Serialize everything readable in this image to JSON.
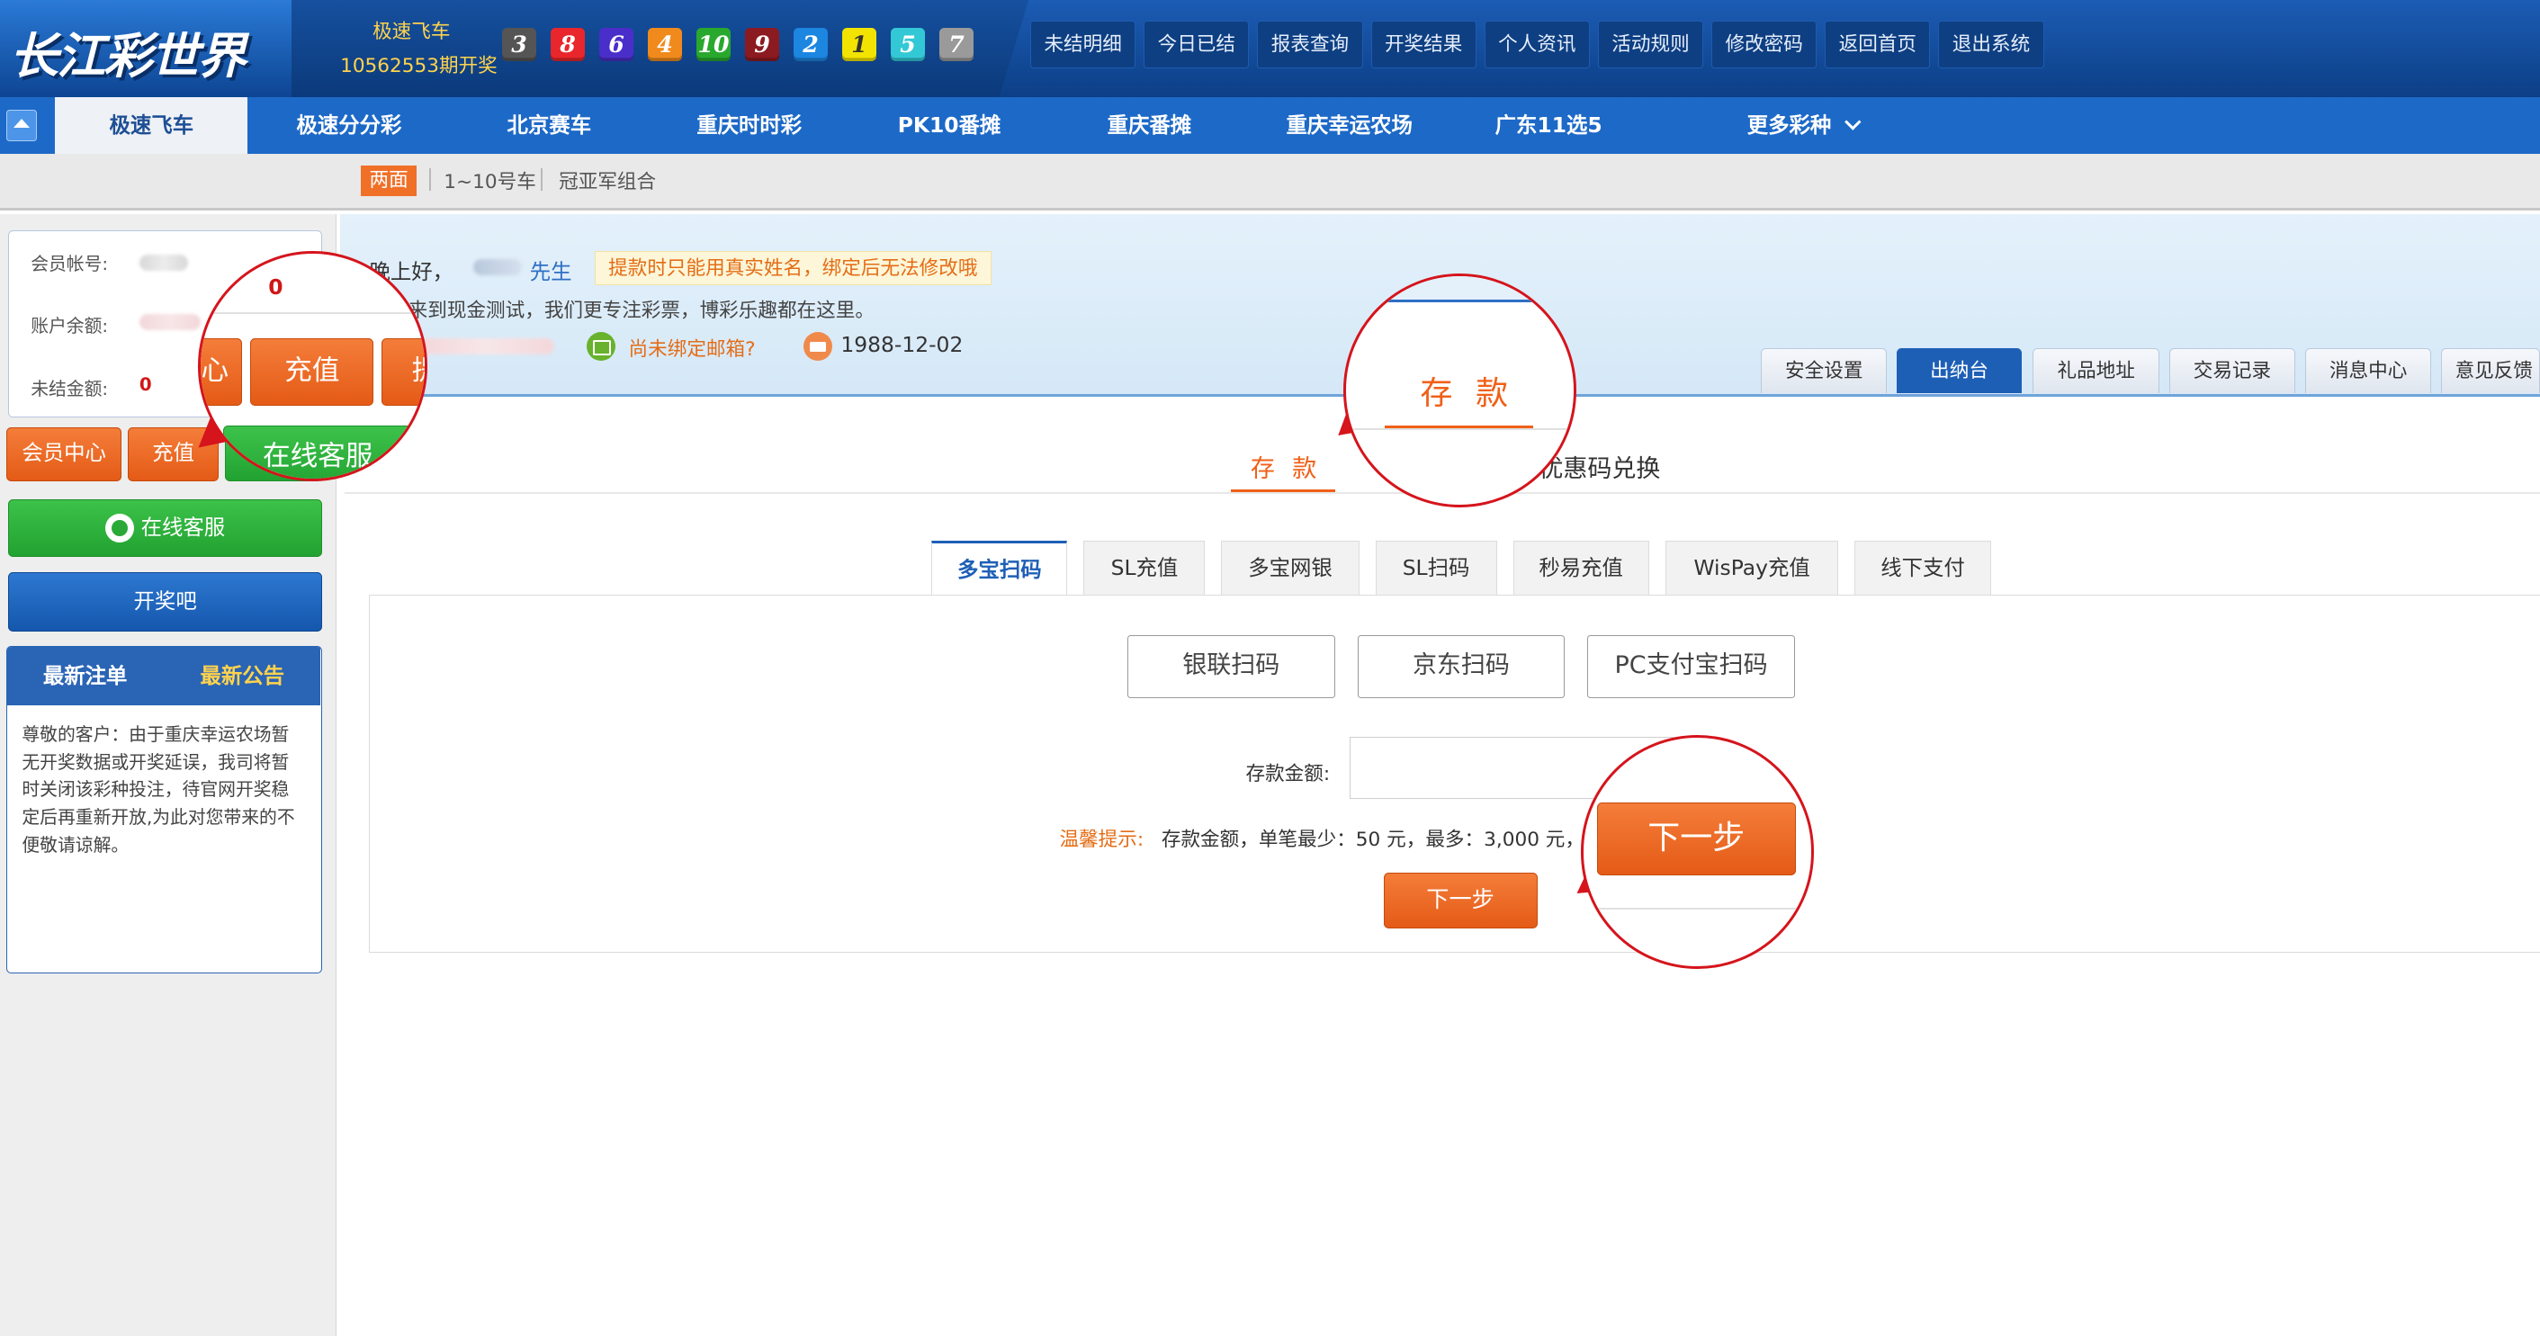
{
  "header": {
    "logo_text": "长江彩世界",
    "draw_name": "极速飞车",
    "draw_period": "10562553期开奖",
    "balls": [
      {
        "num": "3",
        "color": "#555555"
      },
      {
        "num": "8",
        "color": "#e8262b"
      },
      {
        "num": "6",
        "color": "#4a2ec9"
      },
      {
        "num": "4",
        "color": "#f08a1d"
      },
      {
        "num": "10",
        "color": "#29a82e"
      },
      {
        "num": "9",
        "color": "#8c1a21"
      },
      {
        "num": "2",
        "color": "#1c86e0"
      },
      {
        "num": "1",
        "color": "#f2e400"
      },
      {
        "num": "5",
        "color": "#33c8d6"
      },
      {
        "num": "7",
        "color": "#9a9a9a"
      }
    ],
    "nav": [
      "未结明细",
      "今日已结",
      "报表查询",
      "开奖结果",
      "个人资讯",
      "活动规则",
      "修改密码",
      "返回首页",
      "退出系统"
    ]
  },
  "game_tabs": [
    "极速飞车",
    "极速分分彩",
    "北京赛车",
    "重庆时时彩",
    "PK10番摊",
    "重庆番摊",
    "重庆幸运农场",
    "广东11选5",
    "更多彩种"
  ],
  "sub_tabs": [
    "两面",
    "1~10号车",
    "冠亚军组合"
  ],
  "sidebar": {
    "account_label": "会员帐号:",
    "balance_label": "账户余额:",
    "unsettled_label": "未结金额:",
    "unsettled_value": "0",
    "member_center": "会员中心",
    "recharge": "充值",
    "online_service": "在线客服",
    "kaijiang": "开奖吧",
    "notice_tabs": [
      "最新注单",
      "最新公告"
    ],
    "notice_text": "尊敬的客户：由于重庆幸运农场暂无开奖数据或开奖延误，我司将暂时关闭该彩种投注，待官网开奖稳定后再重新开放,为此对您带来的不便敬请谅解。"
  },
  "user": {
    "greeting": "晚上好，",
    "title": "先生",
    "warning": "提款时只能用真实姓名，绑定后无法修改哦",
    "welcome": "欢迎来到现金测试，我们更专注彩票，博彩乐趣都在这里。",
    "email_status": "尚未绑定邮箱?",
    "birthday": "1988-12-02",
    "account_tabs": [
      "安全设置",
      "出纳台",
      "礼品地址",
      "交易记录",
      "消息中心",
      "意见反馈"
    ]
  },
  "deposit": {
    "main_tab": "存 款",
    "promo_tab": "优惠码兑换",
    "pay_tabs": [
      "多宝扫码",
      "SL充值",
      "多宝网银",
      "SL扫码",
      "秒易充值",
      "WisPay充值",
      "线下支付"
    ],
    "methods": [
      "银联扫码",
      "京东扫码",
      "PC支付宝扫码"
    ],
    "amount_label": "存款金额:",
    "amount_value": "",
    "hint_label": "温馨提示:",
    "hint_text": "存款金额，单笔最少：50 元，最多：3,000 元，不收取手续费",
    "next_button": "下一步"
  },
  "callouts": {
    "left_value": "0",
    "left_btn_partial_1": "心",
    "left_btn_recharge": "充值",
    "left_btn_partial_2": "提",
    "left_service": "在线客服",
    "deposit_zoom": "存 款",
    "next_zoom": "下一步"
  },
  "colors": {
    "accent_orange": "#f06018",
    "nav_blue": "#1d69c7",
    "callout_red": "#d5141c"
  }
}
